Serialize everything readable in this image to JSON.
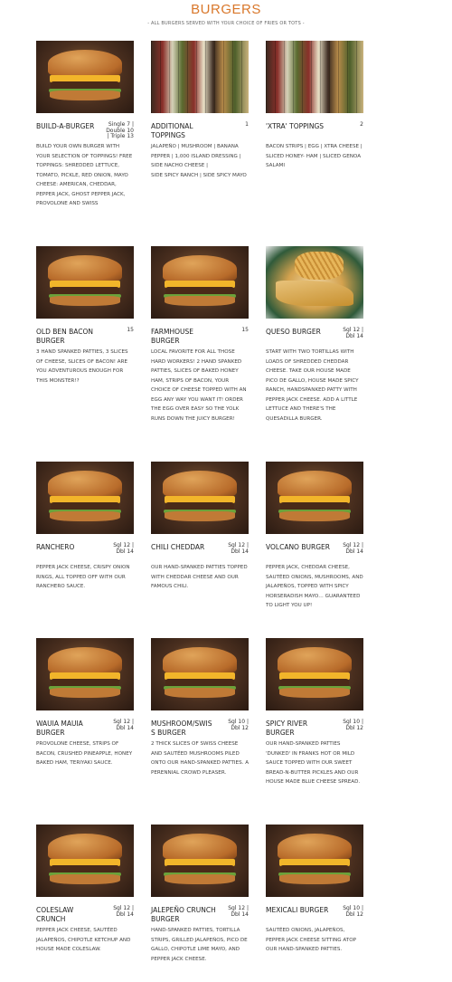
{
  "header": {
    "title": "BURGERS",
    "subtitle": "- ALL BURGERS SERVED WITH YOUR CHOICE OF FRIES OR TOTS -"
  },
  "items": [
    {
      "name": "BUILD-A-BURGER",
      "price": "Single 7 |\nDouble 10\n| Triple 13",
      "photo": "burger",
      "desc": "BUILD YOUR OWN BURGER WITH YOUR SELECTION OF TOPPINGS! FREE TOPPINGS: SHREDDED LETTUCE, TOMATO, PICKLE, RED ONION, MAYO CHEESE: AMERICAN, CHEDDAR, PEPPER JACK, GHOST PEPPER JACK, PROVOLONE AND SWISS"
    },
    {
      "name": "ADDITIONAL TOPPINGS",
      "price": "1",
      "photo": "toppings",
      "desc": "JALAPEÑO | MUSHROOM | BANANA PEPPER | 1,000 ISLAND DRESSING | SIDE NACHO CHEESE |\nSIDE SPICY RANCH | SIDE SPICY MAYO"
    },
    {
      "name": "'XTRA' TOPPINGS",
      "price": "2",
      "photo": "toppings",
      "desc": "BACON STRIPS | EGG | XTRA CHEESE | SLICED HONEY- HAM | SLICED GENOA SALAMI"
    },
    {
      "name": "OLD BEN BACON BURGER",
      "price": "15",
      "photo": "burger",
      "desc": "3 HAND SPANKED PATTIES, 3 SLICES OF CHEESE, SLICES OF BACON! ARE YOU ADVENTUROUS ENOUGH FOR THIS MONSTER!?"
    },
    {
      "name": "FARMHOUSE BURGER",
      "price": "15",
      "photo": "burger",
      "desc": "LOCAL FAVORITE FOR ALL THOSE HARD WORKERS! 2 HAND SPANKED PATTIES, SLICES OF BAKED HONEY HAM, STRIPS OF BACON, YOUR CHOICE OF CHEESE TOPPED WITH AN EGG ANY WAY YOU WANT IT! ORDER THE EGG OVER EASY SO THE YOLK RUNS DOWN THE JUICY BURGER!"
    },
    {
      "name": "QUESO BURGER",
      "price": "Sgl 12 |\nDbl 14",
      "photo": "queso",
      "desc": "START WITH TWO TORTILLAS WITH LOADS OF SHREDDED CHEDDAR CHEESE. TAKE OUR HOUSE MADE PICO DE GALLO, HOUSE MADE SPICY RANCH, HANDSPANKED PATTY WITH PEPPER JACK CHEESE. ADD A LITTLE LETTUCE AND THERE'S THE QUESADILLA BURGER."
    },
    {
      "name": "RANCHERO",
      "price": "Sgl 12 |\nDbl 14",
      "photo": "burger",
      "desc": "PEPPER JACK CHEESE, CRISPY ONION\nRINGS, ALL TOPPED OFF WITH OUR\nRANCHERO SAUCE."
    },
    {
      "name": "CHILI CHEDDAR",
      "price": "Sgl 12 |\nDbl 14",
      "photo": "burger",
      "desc": "OUR HAND-SPANKED PATTIES TOPPED WITH CHEDDAR CHEESE AND OUR FAMOUS CHILI."
    },
    {
      "name": "VOLCANO BURGER",
      "price": "Sgl 12 |\nDbl 14",
      "photo": "burger",
      "desc": "PEPPER JACK, CHEDDAR CHEESE, SAUTÉED ONIONS, MUSHROOMS, AND JALAPEÑOS, TOPPED WITH SPICY HORSERADISH MAYO… GUARANTEED TO LIGHT YOU UP!"
    },
    {
      "name": "WAUIA MAUIA BURGER",
      "price": "Sgl 12 |\nDbl 14",
      "photo": "burger",
      "desc": "PROVOLONE CHEESE, STRIPS OF BACON, CRUSHED PINEAPPLE, HONEY BAKED HAM, TERIYAKI SAUCE."
    },
    {
      "name": "MUSHROOM/SWIS S BURGER",
      "price": "Sgl 10 |\nDbl 12",
      "photo": "burger",
      "desc": "2 THICK SLICES OF SWISS CHEESE AND SAUTÉED MUSHROOMS PILED ONTO OUR HAND-SPANKED PATTIES. A PERENNIAL CROWD PLEASER."
    },
    {
      "name": "SPICY RIVER BURGER",
      "price": "Sgl 10 |\nDbl 12",
      "photo": "burger",
      "desc": "OUR HAND-SPANKED PATTIES 'DUNKED' IN FRANKS HOT OR MILD SAUCE TOPPED WITH OUR SWEET BREAD-N-BUTTER PICKLES AND OUR HOUSE MADE BLUE CHEESE SPREAD."
    },
    {
      "name": "COLESLAW CRUNCH",
      "price": "Sgl 12 |\nDbl 14",
      "photo": "burger",
      "desc": "PEPPER JACK CHEESE, SAUTÉED JALAPEÑOS, CHIPOTLE KETCHUP AND HOUSE MADE COLESLAW."
    },
    {
      "name": "JALEPEÑO CRUNCH BURGER",
      "price": "Sgl 12 |\nDbl 14",
      "photo": "burger",
      "desc": "HAND-SPANKED PATTIES, TORTILLA STRIPS, GRILLED JALAPEÑOS, PICO DE GALLO, CHIPOTLE LIME MAYO, AND PEPPER JACK CHEESE."
    },
    {
      "name": "MEXICALI BURGER",
      "price": "Sgl 10 |\nDbl 12",
      "photo": "burger",
      "desc": "SAUTÉED ONIONS, JALAPEÑOS, PEPPER JACK CHEESE SITTING ATOP OUR HAND-SPANKED PATTIES."
    }
  ]
}
